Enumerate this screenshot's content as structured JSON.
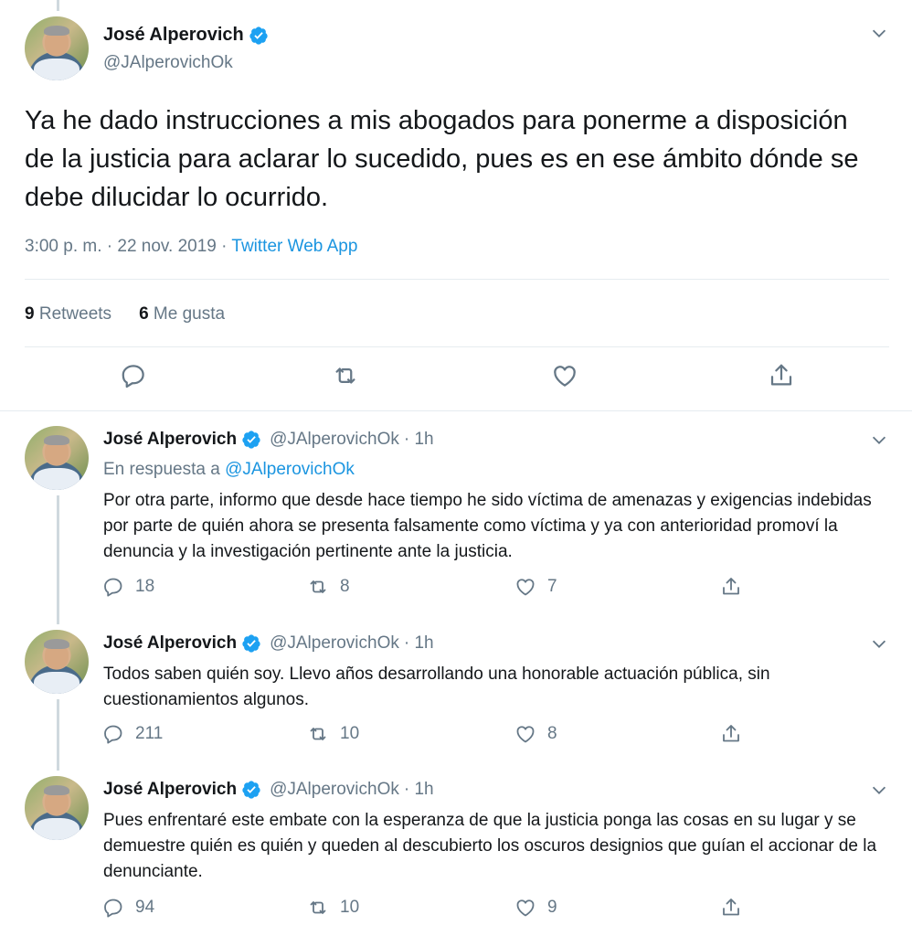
{
  "main_tweet": {
    "author_name": "José Alperovich",
    "handle": "@JAlperovichOk",
    "text": "Ya he dado instrucciones a mis abogados para ponerme a disposición de la justicia para aclarar lo sucedido, pues es en ese ámbito dónde se debe dilucidar lo ocurrido.",
    "time": "3:00 p. m.",
    "date": "22 nov. 2019",
    "separator": "·",
    "source": "Twitter Web App",
    "retweets_count": "9",
    "retweets_label": "Retweets",
    "likes_count": "6",
    "likes_label": "Me gusta"
  },
  "replies": [
    {
      "author_name": "José Alperovich",
      "handle": "@JAlperovichOk",
      "age": "· 1h",
      "in_reply_prefix": "En respuesta a",
      "in_reply_handle": "@JAlperovichOk",
      "text": "Por otra parte, informo que desde hace tiempo he sido víctima de amenazas y exigencias indebidas por parte de quién ahora se presenta falsamente como víctima y ya con anterioridad promoví la denuncia y la investigación pertinente ante la justicia.",
      "replies": "18",
      "retweets": "8",
      "likes": "7"
    },
    {
      "author_name": "José Alperovich",
      "handle": "@JAlperovichOk",
      "age": "· 1h",
      "text": "Todos saben quién soy. Llevo años desarrollando una honorable actuación pública, sin cuestionamientos algunos.",
      "replies": "211",
      "retweets": "10",
      "likes": "8"
    },
    {
      "author_name": "José Alperovich",
      "handle": "@JAlperovichOk",
      "age": "· 1h",
      "text": "Pues enfrentaré este embate con la esperanza de que la justicia ponga las cosas en su lugar y se demuestre quién es quién y queden al descubierto los oscuros designios que guían el accionar de la denunciante.",
      "replies": "94",
      "retweets": "10",
      "likes": "9"
    }
  ],
  "icons": {
    "verified": "verified-badge-icon",
    "reply": "reply-icon",
    "retweet": "retweet-icon",
    "like": "heart-icon",
    "share": "share-icon",
    "more": "chevron-down-icon"
  },
  "colors": {
    "brand_blue": "#1b95e0",
    "muted_text": "#657786",
    "text": "#14171a",
    "border": "#e6ecf0"
  }
}
